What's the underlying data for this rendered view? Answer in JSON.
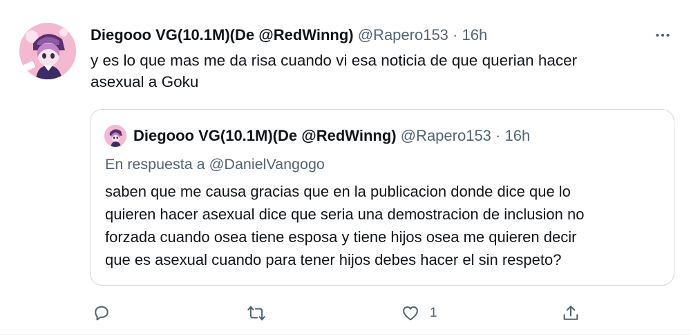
{
  "tweet": {
    "author_name": "Diegooo VG(10.1M)(De @RedWinng)",
    "handle": "@Rapero153",
    "separator": "·",
    "time": "16h",
    "text": "y es lo que mas me da risa cuando vi esa noticia de que querian hacer\nasexual a Goku",
    "more_icon": "more-horizontal-icon"
  },
  "quoted": {
    "author_name": "Diegooo VG(10.1M)(De @RedWinng)",
    "handle": "@Rapero153",
    "separator": "·",
    "time": "16h",
    "reply_prefix": "En respuesta a",
    "reply_to": "@DanielVangogo",
    "text": "saben que me causa gracias que en la publicacion donde dice que lo\nquieren hacer asexual dice que seria una demostracion de inclusion no\nforzada cuando osea tiene esposa y tiene hijos osea me quieren decir\nque es asexual cuando para tener hijos debes hacer el sin respeto?"
  },
  "actions": {
    "reply_icon": "reply-icon",
    "retweet_icon": "retweet-icon",
    "like_icon": "like-heart-icon",
    "like_count": "1",
    "share_icon": "share-icon"
  },
  "colors": {
    "text_primary": "#0f1419",
    "text_secondary": "#536471",
    "border": "#cfd9de"
  }
}
